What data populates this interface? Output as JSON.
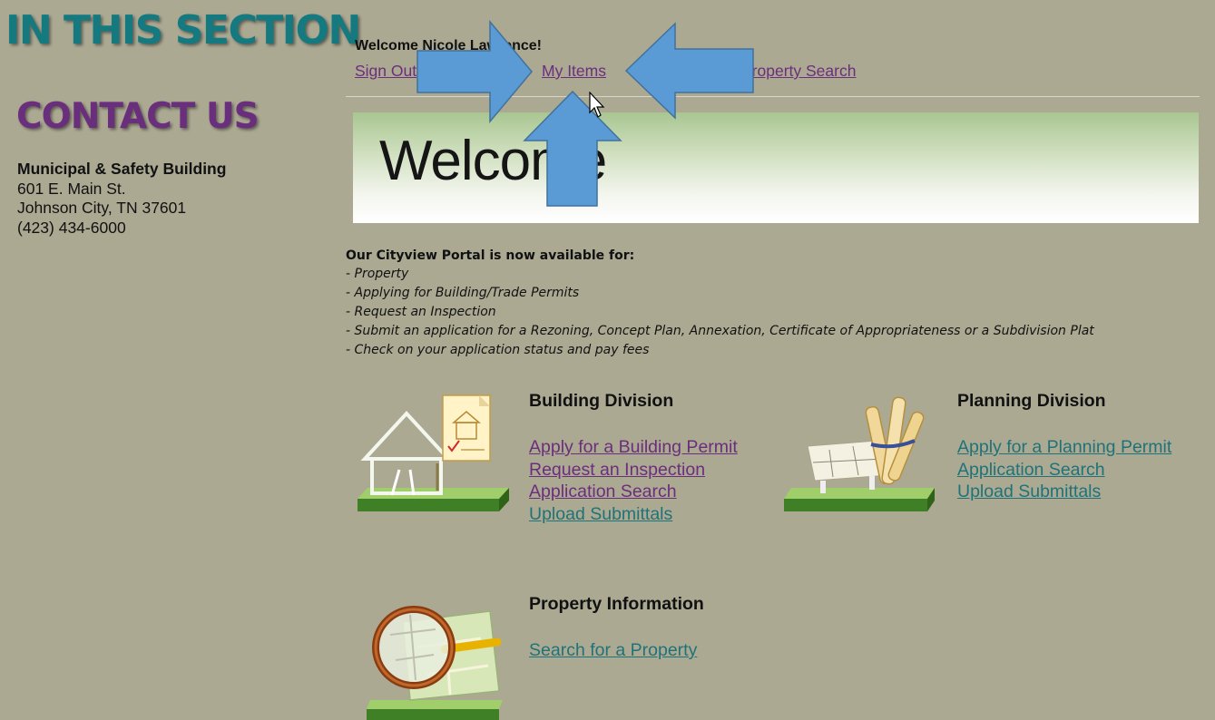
{
  "sidebar": {
    "section_heading": "IN THIS SECTION",
    "contact_heading": "CONTACT US",
    "address": {
      "building": "Municipal & Safety Building",
      "street": "601 E. Main St.",
      "city": "Johnson City, TN 37601",
      "phone": "(423) 434-6000"
    }
  },
  "header": {
    "welcome_message": "Welcome Nicole Lawrence!",
    "links": {
      "sign_out": "Sign Out",
      "my_items": "My Items",
      "property_search": "Property Search"
    }
  },
  "banner": {
    "title": "Welcome"
  },
  "intro": {
    "title": "Our Cityview Portal is now available for:",
    "items": [
      "- Property",
      "- Applying for Building/Trade Permits",
      "- Request an Inspection",
      "- Submit an application for a Rezoning, Concept Plan, Annexation, Certificate of Appropriateness or a Subdivision Plat",
      "- Check on your application status and pay fees"
    ]
  },
  "building_division": {
    "title": "Building Division",
    "links": [
      "Apply for a Building Permit",
      "Request an Inspection",
      "Application Search",
      "Upload Submittals"
    ]
  },
  "planning_division": {
    "title": "Planning Division",
    "links": [
      "Apply for a Planning Permit",
      "Application Search",
      "Upload Submittals"
    ]
  },
  "property_information": {
    "title": "Property Information",
    "links": [
      "Search for a Property"
    ]
  },
  "icons": {
    "building": "house-permit-icon",
    "planning": "blueprint-plans-icon",
    "property": "magnifier-map-icon",
    "arrows": "annotation-arrow-icon",
    "cursor": "mouse-cursor-icon"
  },
  "colors": {
    "background": "#aca993",
    "section_heading": "#157a80",
    "contact_heading": "#6a2f7c",
    "link_visited": "#6b2e7c",
    "link_unvisited": "#1f7378",
    "annotation_arrow": "#5b9bd5"
  }
}
